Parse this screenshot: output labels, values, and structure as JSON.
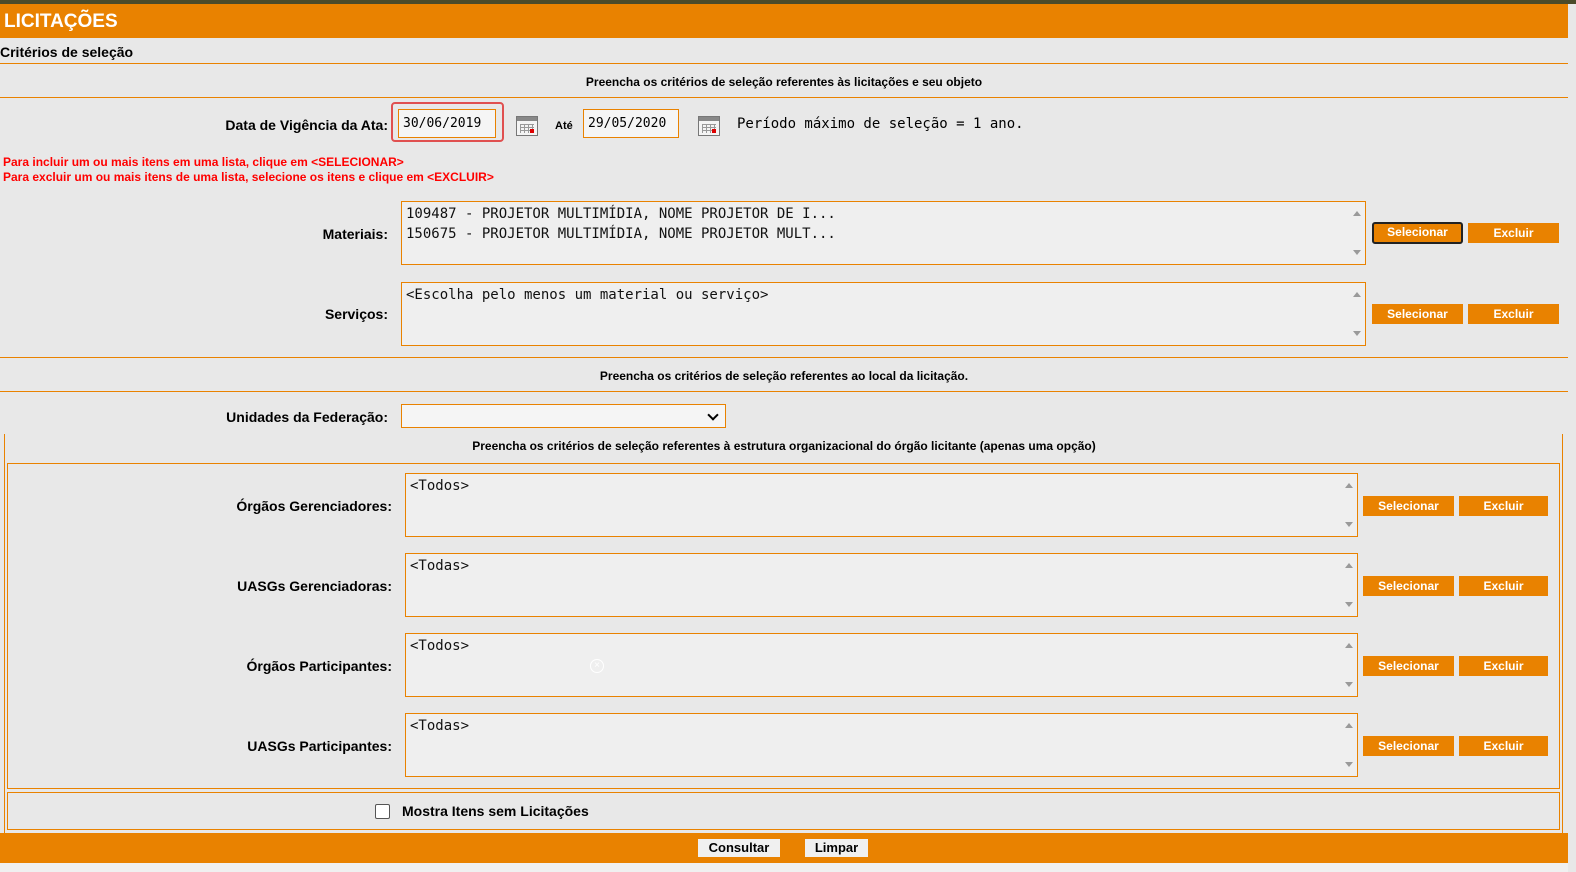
{
  "header": {
    "title": "LICITAÇÕES"
  },
  "subtitle": "Critérios de seleção",
  "sections": {
    "object": "Preencha os critérios de seleção referentes às licitações e seu objeto",
    "location": "Preencha os critérios de seleção referentes ao local da licitação.",
    "org": "Preencha os critérios de seleção referentes à estrutura organizacional do órgão licitante (apenas uma opção)"
  },
  "vigencia": {
    "label": "Data de Vigência da Ata:",
    "from": "30/06/2019",
    "to_label": "Até",
    "to": "29/05/2020",
    "note": "Período máximo de seleção = 1 ano."
  },
  "instructions": {
    "line1": "Para incluir um ou mais itens em uma lista, clique em <SELECIONAR>",
    "line2": "Para excluir um ou mais itens de uma lista, selecione os itens e clique em <EXCLUIR>"
  },
  "buttons": {
    "select": "Selecionar",
    "delete": "Excluir"
  },
  "materiais": {
    "label": "Materiais:",
    "items": [
      "109487 - PROJETOR MULTIMÍDIA, NOME PROJETOR DE I...",
      "150675 - PROJETOR MULTIMÍDIA, NOME PROJETOR MULT..."
    ]
  },
  "servicos": {
    "label": "Serviços:",
    "items": [
      "<Escolha pelo menos um material ou serviço>"
    ]
  },
  "uf": {
    "label": "Unidades da Federação:",
    "selected": ""
  },
  "orgaos_gerenciadores": {
    "label": "Órgãos Gerenciadores:",
    "items": [
      "<Todos>"
    ]
  },
  "uasgs_gerenciadoras": {
    "label": "UASGs Gerenciadoras:",
    "items": [
      "<Todas>"
    ]
  },
  "orgaos_participantes": {
    "label": "Órgãos Participantes:",
    "items": [
      "<Todos>"
    ]
  },
  "uasgs_participantes": {
    "label": "UASGs Participantes:",
    "items": [
      "<Todas>"
    ]
  },
  "checkbox": {
    "label": "Mostra Itens sem Licitações",
    "checked": false
  },
  "footer": {
    "consultar": "Consultar",
    "limpar": "Limpar"
  },
  "icons": [
    "calendar-icon",
    "chevron-down-icon",
    "scroll-up-icon",
    "scroll-down-icon",
    "clear-icon"
  ],
  "colors": {
    "accent": "#e98200",
    "background": "#e8e8e8",
    "warning_text": "#ff0000"
  }
}
